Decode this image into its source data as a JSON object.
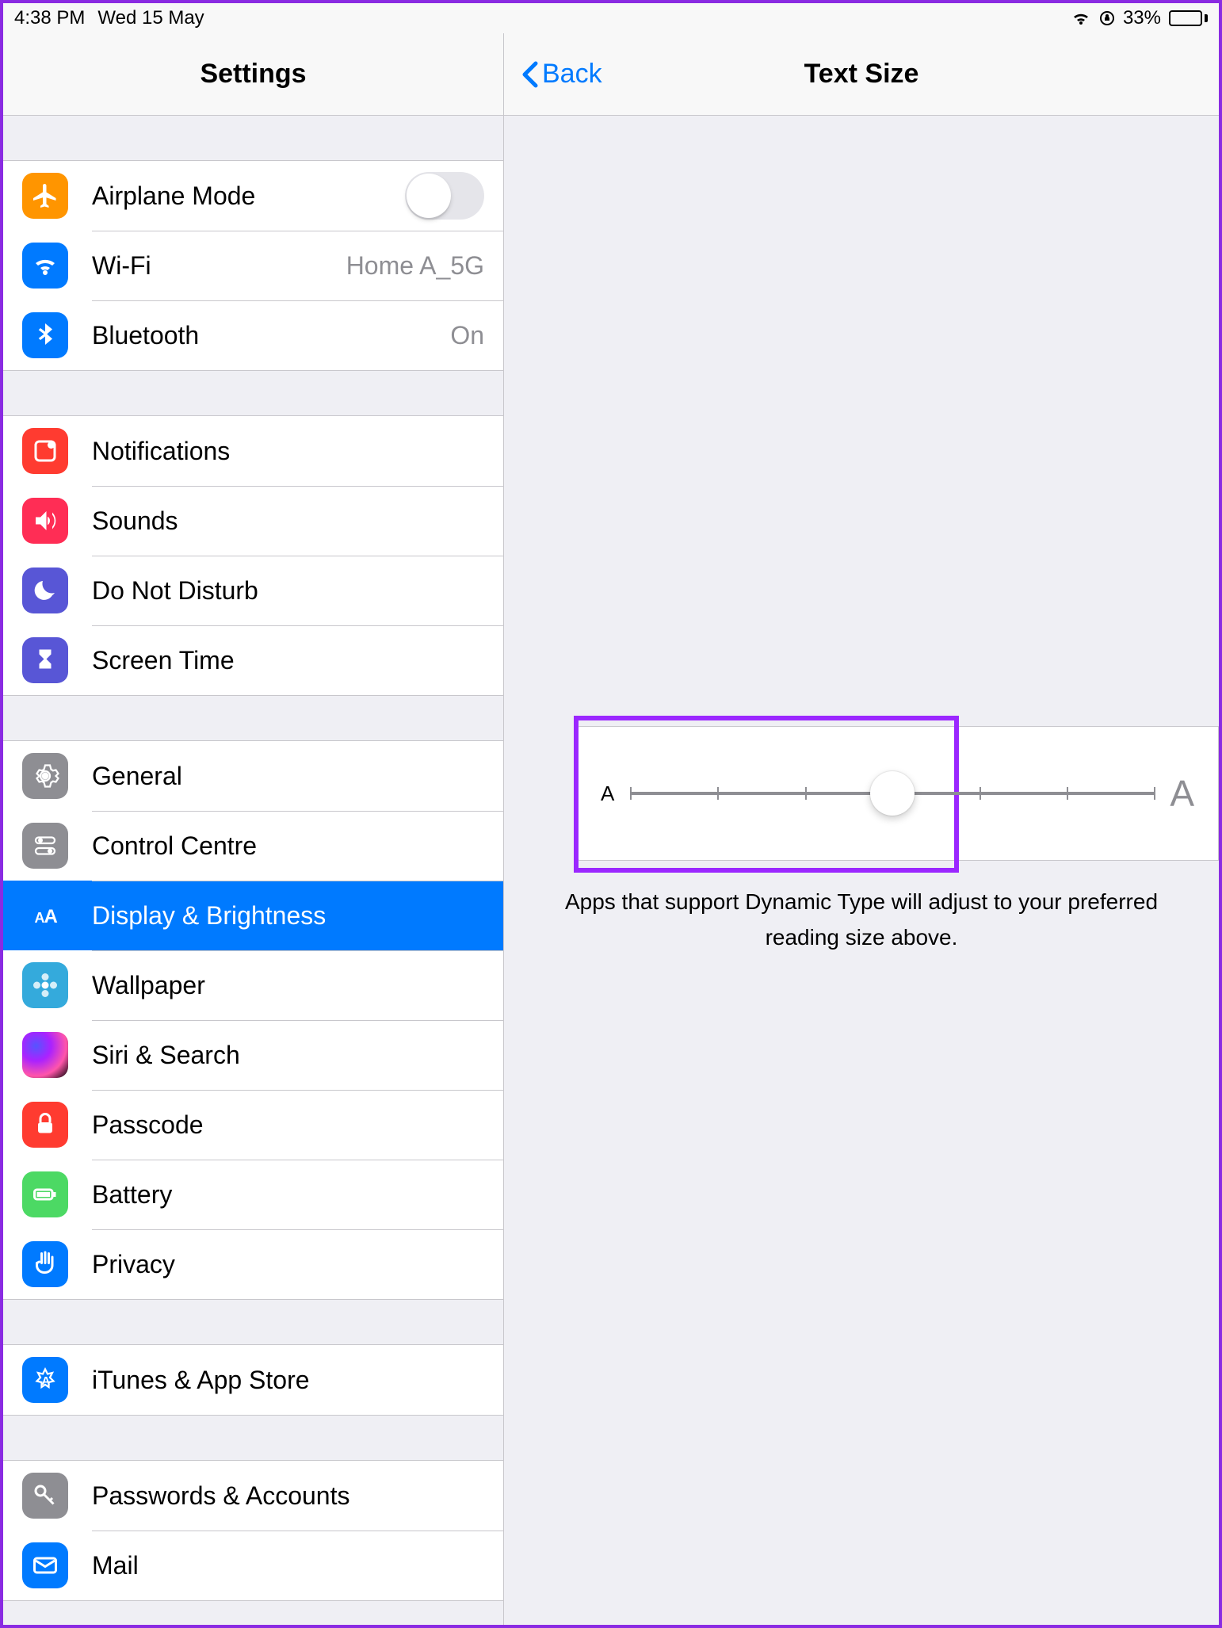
{
  "status": {
    "time": "4:38 PM",
    "date": "Wed 15 May",
    "battery_pct": "33%"
  },
  "sidebar": {
    "title": "Settings",
    "groups": [
      {
        "rows": [
          {
            "id": "airplane",
            "label": "Airplane Mode",
            "detail": "",
            "switch": true,
            "icon": "airplane-icon",
            "color": "ic-orange"
          },
          {
            "id": "wifi",
            "label": "Wi-Fi",
            "detail": "Home A_5G",
            "icon": "wifi-icon",
            "color": "ic-blue"
          },
          {
            "id": "bluetooth",
            "label": "Bluetooth",
            "detail": "On",
            "icon": "bluetooth-icon",
            "color": "ic-blue"
          }
        ]
      },
      {
        "rows": [
          {
            "id": "notifications",
            "label": "Notifications",
            "icon": "notifications-icon",
            "color": "ic-red"
          },
          {
            "id": "sounds",
            "label": "Sounds",
            "icon": "sounds-icon",
            "color": "ic-pink"
          },
          {
            "id": "dnd",
            "label": "Do Not Disturb",
            "icon": "moon-icon",
            "color": "ic-indigo"
          },
          {
            "id": "screentime",
            "label": "Screen Time",
            "icon": "hourglass-icon",
            "color": "ic-indigo"
          }
        ]
      },
      {
        "rows": [
          {
            "id": "general",
            "label": "General",
            "icon": "gear-icon",
            "color": "ic-gray"
          },
          {
            "id": "controlcentre",
            "label": "Control Centre",
            "icon": "switches-icon",
            "color": "ic-gray"
          },
          {
            "id": "display",
            "label": "Display & Brightness",
            "icon": "textsize-icon",
            "color": "ic-blue",
            "selected": true
          },
          {
            "id": "wallpaper",
            "label": "Wallpaper",
            "icon": "flower-icon",
            "color": "ic-teal"
          },
          {
            "id": "siri",
            "label": "Siri & Search",
            "icon": "siri-icon",
            "color": ""
          },
          {
            "id": "passcode",
            "label": "Passcode",
            "icon": "lock-icon",
            "color": "ic-red"
          },
          {
            "id": "battery",
            "label": "Battery",
            "icon": "battery-icon",
            "color": "ic-green"
          },
          {
            "id": "privacy",
            "label": "Privacy",
            "icon": "hand-icon",
            "color": "ic-blue"
          }
        ]
      },
      {
        "rows": [
          {
            "id": "itunes",
            "label": "iTunes & App Store",
            "icon": "appstore-icon",
            "color": "ic-blue"
          }
        ]
      },
      {
        "rows": [
          {
            "id": "passwords",
            "label": "Passwords & Accounts",
            "icon": "key-icon",
            "color": "ic-gray"
          },
          {
            "id": "mail",
            "label": "Mail",
            "icon": "mail-icon",
            "color": "ic-blue"
          }
        ]
      }
    ]
  },
  "detail": {
    "back_label": "Back",
    "title": "Text Size",
    "slider": {
      "small_label": "A",
      "large_label": "A",
      "steps": 7,
      "value_index": 3
    },
    "footer": "Apps that support Dynamic Type will adjust to your preferred reading size above."
  },
  "colors": {
    "highlight": "#9b27ff",
    "selected": "#007aff"
  }
}
